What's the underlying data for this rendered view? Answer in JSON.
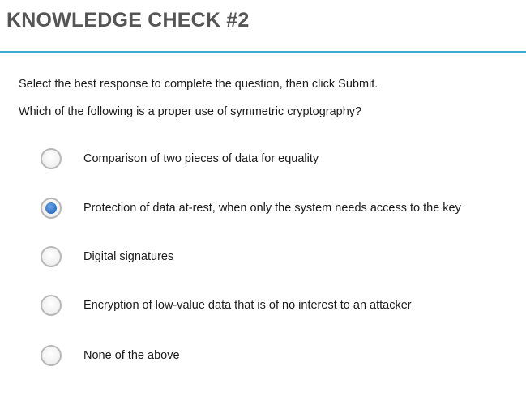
{
  "header": {
    "title": "KNOWLEDGE CHECK #2",
    "accent_color": "#3fa9d6"
  },
  "content": {
    "instruction": "Select the best response to complete the question, then click Submit.",
    "question": "Which of the following is a proper use of symmetric cryptography?"
  },
  "options": [
    {
      "label": "Comparison of two pieces of data for equality",
      "selected": false
    },
    {
      "label": "Protection of data at-rest, when only the system needs access to the key",
      "selected": true
    },
    {
      "label": "Digital signatures",
      "selected": false
    },
    {
      "label": "Encryption of low-value data that is of no interest to an attacker",
      "selected": false
    },
    {
      "label": "None of the above",
      "selected": false
    }
  ],
  "selected_color": "#2f6fc4"
}
